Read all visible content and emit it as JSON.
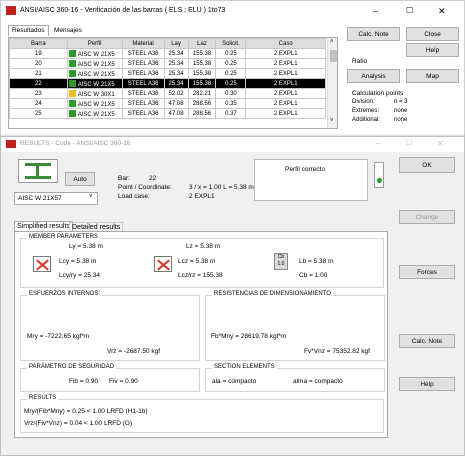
{
  "main_window": {
    "title": "ANSI/AISC 360-16 - Verificación de las barras ( ELS ; ELU ) 1to73",
    "tabs": [
      "Resultados",
      "Mensajes"
    ],
    "columns": [
      "Barra",
      "Perfil",
      "Material",
      "Lay",
      "Laz",
      "Solicit.",
      "Caso"
    ],
    "rows": [
      {
        "barra": "19",
        "icon": "ok",
        "perfil": "AISC W 21X5",
        "material": "STEEL A36",
        "lay": "25.34",
        "laz": "155.38",
        "solicit": "0.25",
        "caso": "2 EXPL1"
      },
      {
        "barra": "20",
        "icon": "ok",
        "perfil": "AISC W 21X5",
        "material": "STEEL A36",
        "lay": "25.34",
        "laz": "155.38",
        "solicit": "0.25",
        "caso": "2 EXPL1"
      },
      {
        "barra": "21",
        "icon": "ok",
        "perfil": "AISC W 21X5",
        "material": "STEEL A36",
        "lay": "25.34",
        "laz": "155.38",
        "solicit": "0.25",
        "caso": "2 EXPL1"
      },
      {
        "barra": "22",
        "icon": "ok",
        "perfil": "AISC W 21X5",
        "material": "STEEL A36",
        "lay": "25.34",
        "laz": "155.38",
        "solicit": "0.25",
        "caso": "2 EXPL1"
      },
      {
        "barra": "23",
        "icon": "warn",
        "perfil": "AISC W 30X1",
        "material": "STEEL A36",
        "lay": "52.02",
        "laz": "282.21",
        "solicit": "0.30",
        "caso": "2 EXPL1"
      },
      {
        "barra": "24",
        "icon": "ok",
        "perfil": "AISC W 21X5",
        "material": "STEEL A36",
        "lay": "47.08",
        "laz": "288.56",
        "solicit": "0.35",
        "caso": "2 EXPL1"
      },
      {
        "barra": "25",
        "icon": "ok",
        "perfil": "AISC W 21X5",
        "material": "STEEL A36",
        "lay": "47.08",
        "laz": "288.56",
        "solicit": "0.37",
        "caso": "2 EXPL1"
      }
    ],
    "selected_row": "22",
    "buttons": {
      "calc_note": "Calc. Note",
      "close": "Close",
      "help": "Help",
      "analysis": "Analysis",
      "map": "Map"
    },
    "ratio_label": "Ratio",
    "calc_points": {
      "title": "Calculation points",
      "division_label": "Division:",
      "division_value": "n = 3",
      "extremes_label": "Extremes:",
      "extremes_value": "none",
      "additional_label": "Additional:",
      "additional_value": "none"
    },
    "win_controls": {
      "min": "–",
      "max": "☐",
      "close": "✕"
    }
  },
  "results_window": {
    "title": "RESULTS - Code - ANSI/AISC 360-16",
    "auto_label": "Auto",
    "section_select": "AISC W 21X57",
    "bar_label": "Bar:",
    "bar_value": "22",
    "point_label": "Point / Coordinate:",
    "point_value": "3 / x = 1.00 L = 5.38 m",
    "load_label": "Load case:",
    "load_value": "2 EXPL1",
    "status": "Perfil correcto",
    "tabs": [
      "Simplified results",
      "Detailed results"
    ],
    "member": {
      "title": "MEMBER PARAMETERS",
      "ly": "Ly = 5.38 m",
      "lcy": "Lcy = 5.38 m",
      "lcyry": "Lcy/ry = 25.34",
      "lz": "Lz = 5.38 m",
      "lcz": "Lcz = 5.38 m",
      "lczrz": "Lcz/rz = 155.38",
      "cb_icon_top": "Cb",
      "cb_icon_bot": "1.0",
      "lb": "Lb = 5.38 m",
      "cb": "Cb = 1.00"
    },
    "esfuerzos": {
      "title": "ESFUERZOS INTERNOS:",
      "mry": "Mry = -7222.65 kgf*m",
      "vrz": "Vrz = -2687.50 kgf"
    },
    "resistencias": {
      "title": "RESISTENCIAS DE DIMENSIONAMIENTO",
      "mny": "Fb*Mny = 28619.78 kgf*m",
      "vnz": "Fv*Vnz = 75352.82 kgf"
    },
    "seguridad": {
      "title": "PARÁMETRO DE SEGURIDAD",
      "fb": "Fib = 0.90",
      "fv": "Fiv = 0.90"
    },
    "section": {
      "title": "SECTION ELEMENTS",
      "ala": "ala = compacto",
      "alma": "alma = compacto"
    },
    "results": {
      "title": "RESULTS",
      "line1": "Mry/(Fib*Mny) = 0.25 < 1.00   LRFD (H1-1b)",
      "line2": "Vrz/(Fiv*Vnz) = 0.04 < 1.00   LRFD (G)"
    },
    "buttons": {
      "ok": "OK",
      "change": "Change",
      "forces": "Forces",
      "calc_note": "Calc. Note",
      "help": "Help"
    },
    "win_controls": {
      "min": "–",
      "max": "☐",
      "close": "✕"
    }
  }
}
